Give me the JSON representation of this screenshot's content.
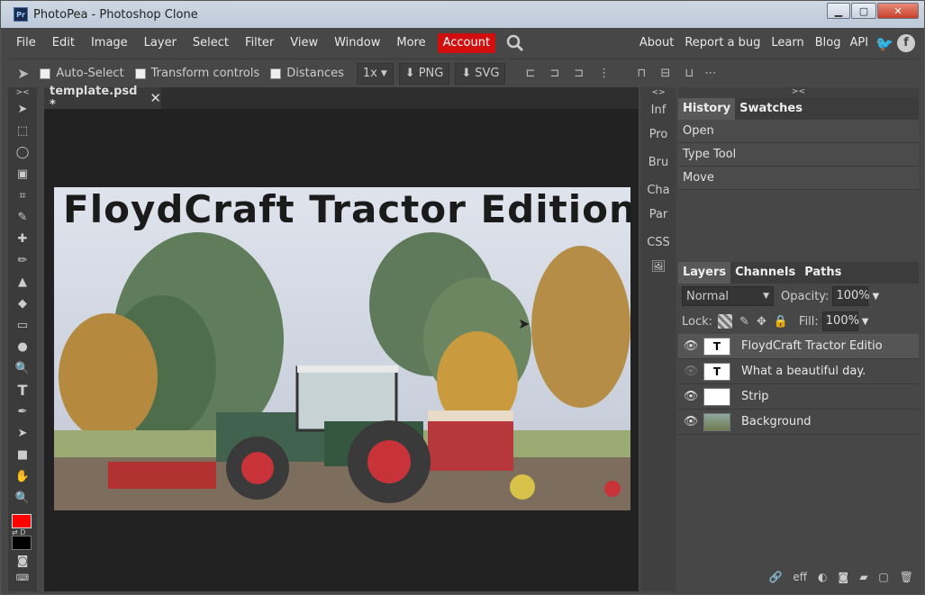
{
  "window": {
    "title": "PhotoPea - Photoshop Clone",
    "app_icon": "Pr"
  },
  "menu": {
    "left": [
      "File",
      "Edit",
      "Image",
      "Layer",
      "Select",
      "Filter",
      "View",
      "Window",
      "More"
    ],
    "account": "Account",
    "right": [
      "About",
      "Report a bug",
      "Learn",
      "Blog",
      "API"
    ]
  },
  "toolbar": {
    "auto_select": "Auto-Select",
    "transform_controls": "Transform controls",
    "distances": "Distances",
    "zoom": "1x",
    "png": "PNG",
    "svg": "SVG"
  },
  "document": {
    "tab_label": "template.psd *",
    "canvas_title": "FloydCraft Tractor Edition"
  },
  "mini_panels": [
    "Inf",
    "Pro",
    "Bru",
    "Cha",
    "Par",
    "CSS"
  ],
  "history": {
    "tabs": [
      "History",
      "Swatches"
    ],
    "items": [
      "Open",
      "Type Tool",
      "Move"
    ]
  },
  "layers": {
    "tabs": [
      "Layers",
      "Channels",
      "Paths"
    ],
    "blend_mode": "Normal",
    "opacity_label": "Opacity:",
    "opacity": "100%",
    "lock_label": "Lock:",
    "fill_label": "Fill:",
    "fill": "100%",
    "items": [
      {
        "name": "FloydCraft Tractor Editio",
        "thumb": "T"
      },
      {
        "name": "What a beautiful day.",
        "thumb": "T"
      },
      {
        "name": "Strip",
        "thumb": ""
      },
      {
        "name": "Background",
        "thumb": ""
      }
    ]
  },
  "bottom": {
    "eff": "eff"
  },
  "colors": {
    "foreground": "#ff0000",
    "background": "#000000",
    "accent": "#d20f0f"
  }
}
